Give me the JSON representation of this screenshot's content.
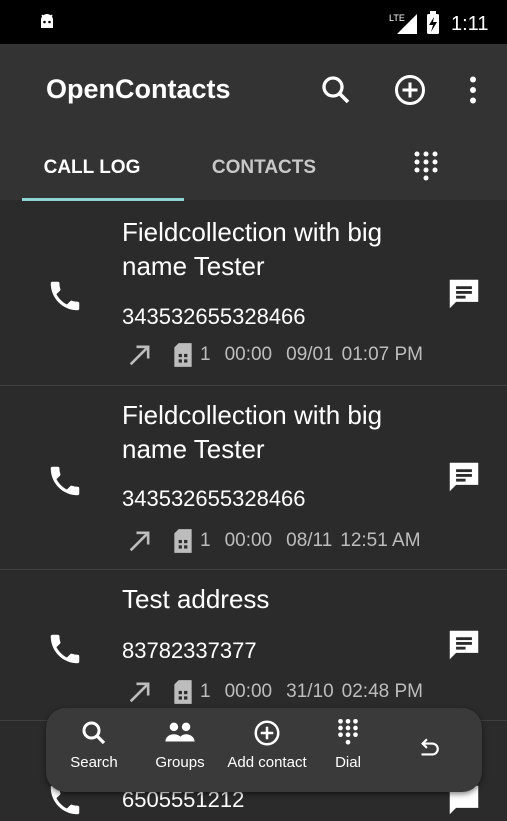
{
  "status": {
    "time": "1:11",
    "network": "LTE"
  },
  "appbar": {
    "title": "OpenContacts",
    "icons": [
      "search-icon",
      "add-circle-icon",
      "more-vert-icon"
    ]
  },
  "tabs": [
    {
      "label": "CALL LOG",
      "selected": true
    },
    {
      "label": "CONTACTS",
      "selected": false
    },
    {
      "label": "",
      "icon": "dialpad-icon"
    }
  ],
  "call_log": [
    {
      "name": "Fieldcollection with big name Tester",
      "number": "343532655328466",
      "sim": "1",
      "duration": "00:00",
      "date": "09/01",
      "time": "01:07 PM"
    },
    {
      "name": "Fieldcollection with big name Tester",
      "number": "343532655328466",
      "sim": "1",
      "duration": "00:00",
      "date": "08/11",
      "time": "12:51 AM"
    },
    {
      "name": "Test address",
      "number": "83782337377",
      "sim": "1",
      "duration": "00:00",
      "date": "31/10",
      "time": "02:48 PM"
    },
    {
      "name": "",
      "number": "6505551212"
    }
  ],
  "bottom_bar": {
    "search": "Search",
    "groups": "Groups",
    "add_contact": "Add contact",
    "dial": "Dial",
    "undo_icon": "undo-icon"
  }
}
